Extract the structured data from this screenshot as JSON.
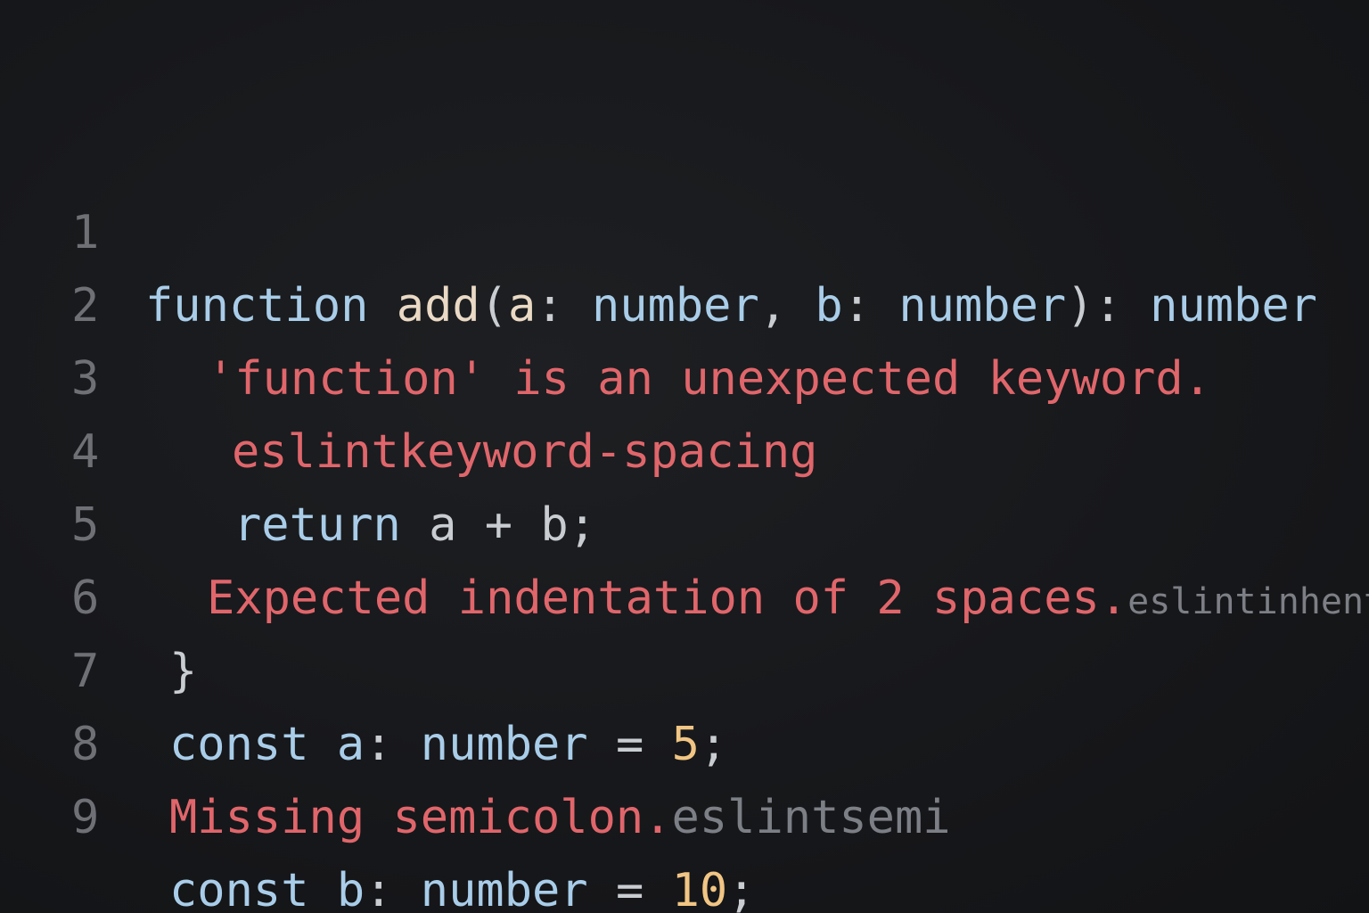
{
  "editor": {
    "lines": [
      {
        "number": "1",
        "tokens": [
          {
            "text": "function",
            "kind": "keyword"
          },
          {
            "text": " ",
            "kind": "space"
          },
          {
            "text": "add",
            "kind": "function-name"
          },
          {
            "text": "(",
            "kind": "punct"
          },
          {
            "text": "a",
            "kind": "identifier"
          },
          {
            "text": ": ",
            "kind": "punct"
          },
          {
            "text": "number",
            "kind": "type"
          },
          {
            "text": ", ",
            "kind": "punct"
          },
          {
            "text": "b",
            "kind": "identifier"
          },
          {
            "text": ": ",
            "kind": "punct"
          },
          {
            "text": "number",
            "kind": "type"
          },
          {
            "text": "): ",
            "kind": "punct"
          },
          {
            "text": "number",
            "kind": "type"
          }
        ]
      },
      {
        "number": "2",
        "message": "'function' is an unexpected keyword."
      },
      {
        "number": "3",
        "message": "eslintkeyword-spacing"
      },
      {
        "number": "4",
        "tokens": [
          {
            "text": "return",
            "kind": "keyword"
          },
          {
            "text": " a + b;",
            "kind": "punct"
          }
        ]
      },
      {
        "number": "5",
        "message": "Expected indentation of 2 spaces.",
        "rule": "eslintinhent"
      },
      {
        "number": "6",
        "brace": "}"
      },
      {
        "number": "7",
        "tokens": [
          {
            "text": "const",
            "kind": "keyword"
          },
          {
            "text": " ",
            "kind": "space"
          },
          {
            "text": "a",
            "kind": "identifier"
          },
          {
            "text": ": ",
            "kind": "punct"
          },
          {
            "text": "number",
            "kind": "type"
          },
          {
            "text": " = ",
            "kind": "punct"
          },
          {
            "text": "5",
            "kind": "number"
          },
          {
            "text": ";",
            "kind": "punct"
          }
        ]
      },
      {
        "number": "8",
        "message": "Missing semicolon.",
        "rule": "eslintsemi"
      },
      {
        "number": "9",
        "tokens": [
          {
            "text": "const",
            "kind": "keyword"
          },
          {
            "text": " ",
            "kind": "space"
          },
          {
            "text": "b",
            "kind": "identifier"
          },
          {
            "text": ": ",
            "kind": "punct"
          },
          {
            "text": "number",
            "kind": "type"
          },
          {
            "text": " = ",
            "kind": "punct"
          },
          {
            "text": "10",
            "kind": "number"
          },
          {
            "text": ";",
            "kind": "punct"
          }
        ]
      }
    ]
  },
  "colors": {
    "background": "#17181b",
    "line_number": "#6e7076",
    "keyword": "#a9cde9",
    "function_name": "#ead9c4",
    "number_literal": "#f1c584",
    "error": "#e0666b",
    "rule_id": "#7c7f85"
  }
}
